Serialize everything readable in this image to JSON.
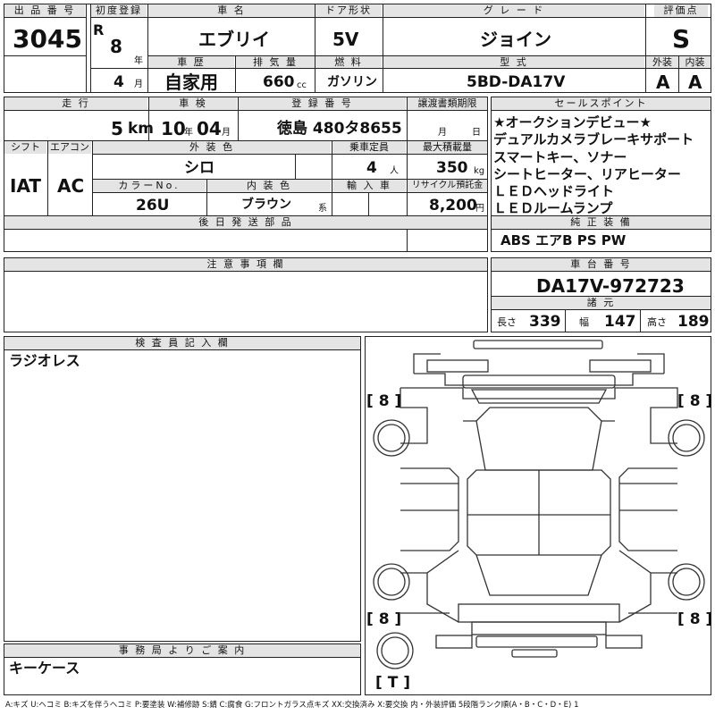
{
  "header": {
    "lot_number_label": "出 品 番 号",
    "lot_number": "3045",
    "first_reg_label": "初度登録",
    "era": "R",
    "first_reg_year": "8",
    "first_reg_year_unit": "年",
    "first_reg_month": "4",
    "first_reg_month_unit": "月",
    "car_name_label": "車 名",
    "car_name": "エブリイ",
    "door_label": "ドア形状",
    "door": "5V",
    "grade_label": "グ レ ー ド",
    "grade": "ジョイン",
    "score_label": "評価点",
    "score": "S",
    "history_label": "車 歴",
    "history": "自家用",
    "displacement_label": "排 気 量",
    "displacement": "660",
    "displacement_unit": "cc",
    "fuel_label": "燃 料",
    "fuel": "ガソリン",
    "model_label": "型 式",
    "model": "5BD-DA17V",
    "exterior_grade_label": "外装",
    "exterior_grade": "A",
    "interior_grade_label": "内装",
    "interior_grade": "A"
  },
  "row2": {
    "mileage_label": "走 行",
    "mileage": "5",
    "mileage_unit": "km",
    "inspection_label": "車 検",
    "inspection_year": "10",
    "inspection_year_unit": "年",
    "inspection_month": "04",
    "inspection_month_unit": "月",
    "registration_label": "登 録 番 号",
    "registration": "徳島 480タ8655",
    "transfer_label": "譲渡書類期限",
    "transfer_month_unit": "月",
    "transfer_day_unit": "日",
    "shift_label": "シフト",
    "shift": "IAT",
    "aircon_label": "エアコン",
    "aircon": "AC",
    "ext_color_label": "外 装 色",
    "ext_color": "シロ",
    "capacity_label": "乗車定員",
    "capacity": "4",
    "capacity_unit": "人",
    "max_load_label": "最大積載量",
    "max_load": "350",
    "max_load_unit": "kg",
    "color_no_label": "カラーNo.",
    "color_no": "26U",
    "int_color_label": "内 装 色",
    "int_color": "ブラウン",
    "int_color_suffix": "系",
    "import_label": "輸 入 車",
    "recycle_label": "リサイクル預託金",
    "recycle": "8,200",
    "recycle_unit": "円",
    "later_parts_label": "後 日 発 送 部 品"
  },
  "selling_points": {
    "label": "セールスポイント",
    "lines": [
      "★オークションデビュー★",
      "デュアルカメラブレーキサポート",
      "スマートキー、ソナー",
      "シートヒーター、リアヒーター",
      "ＬＥＤヘッドライト",
      "ＬＥＤルームランプ"
    ]
  },
  "equipment": {
    "label": "純 正 装 備",
    "value": "ABS エアB PS PW"
  },
  "notes": {
    "label": "注 意 事 項 欄"
  },
  "chassis": {
    "label": "車 台 番 号",
    "value": "DA17V-972723",
    "dims_label": "諸 元",
    "length_label": "長さ",
    "length": "339",
    "width_label": "幅",
    "width": "147",
    "height_label": "高さ",
    "height": "189"
  },
  "inspector": {
    "label": "検 査 員 記 入 欄",
    "text": "ラジオレス"
  },
  "office": {
    "label": "事 務 局 よ り ご 案 内",
    "text": "キーケース"
  },
  "diagram": {
    "tire_front_left": "[ 8 ]",
    "tire_front_right": "[ 8 ]",
    "tire_rear_left": "[ 8 ]",
    "tire_rear_right": "[ 8 ]",
    "spare": "[ T ]"
  },
  "legend": "A:キズ U:ヘコミ B:キズを伴うヘコミ P:要塗装 W:補修跡 S:錆 C:腐食 G:フロントガラス点キズ XX:交換済み X:要交換 内・外装評価 5段階ランク順(A・B・C・D・E) 1"
}
